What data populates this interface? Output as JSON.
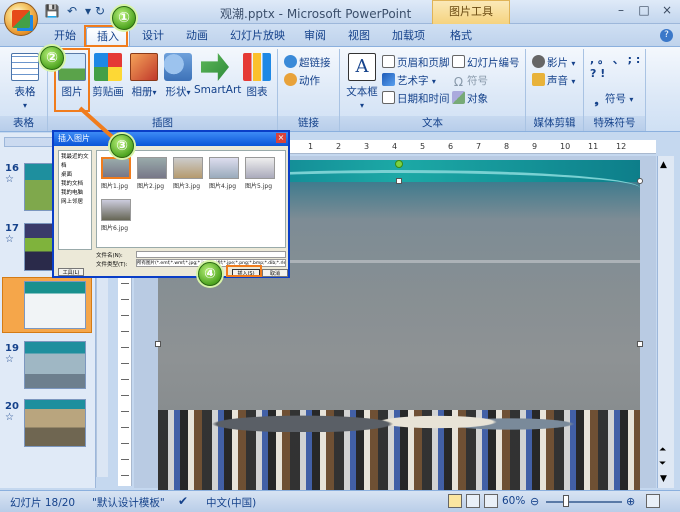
{
  "window": {
    "title": "观潮.pptx - Microsoft PowerPoint",
    "context_tab_title": "图片工具",
    "controls": [
      "–",
      "□",
      "×"
    ]
  },
  "tabs": [
    "开始",
    "插入",
    "设计",
    "动画",
    "幻灯片放映",
    "审阅",
    "视图",
    "加载项",
    "格式"
  ],
  "active_tab": "插入",
  "ribbon": {
    "groups": {
      "table": {
        "label": "表格",
        "button": "表格"
      },
      "illustrations": {
        "label": "插图",
        "buttons": [
          "图片",
          "剪贴画",
          "相册",
          "形状",
          "SmartArt",
          "图表"
        ]
      },
      "links": {
        "label": "链接",
        "buttons": [
          "超链接",
          "动作"
        ]
      },
      "text": {
        "label": "文本",
        "big": "文本框",
        "buttons": [
          "页眉和页脚",
          "幻灯片编号",
          "艺术字",
          "符号",
          "日期和时间",
          "对象"
        ]
      },
      "media": {
        "label": "媒体剪辑",
        "buttons": [
          "影片",
          "声音"
        ]
      },
      "special": {
        "label": "特殊符号",
        "symbols": ", 。 、 ; : ? !",
        "button": "符号"
      }
    }
  },
  "slides": [
    {
      "num": "16",
      "mark": "☆"
    },
    {
      "num": "17",
      "mark": "☆"
    },
    {
      "num": "18",
      "mark": "☆"
    },
    {
      "num": "19",
      "mark": "☆"
    },
    {
      "num": "20",
      "mark": "☆"
    }
  ],
  "ruler_numbers": [
    "4",
    "3",
    "2",
    "1",
    "0",
    "1",
    "2",
    "3",
    "4",
    "5",
    "6",
    "7",
    "8",
    "9",
    "10",
    "11",
    "12"
  ],
  "dialog": {
    "title": "插入图片",
    "places": [
      "我最近的文档",
      "桌面",
      "我的文档",
      "我的电脑",
      "网上邻居"
    ],
    "files": [
      "图片1.jpg",
      "图片2.jpg",
      "图片3.jpg",
      "图片4.jpg",
      "图片5.jpg",
      "图片6.jpg"
    ],
    "filename_label": "文件名(N):",
    "filetype_label": "文件类型(T):",
    "filetype_value": "所有图片(*.emf;*.wmf;*.jpg;*.jpeg;*.jfif;*.jpe;*.png;*.bmp;*.dib;*.rle;*.gif;*.emz;*.wmz)",
    "tools": "工具(L)",
    "insert": "插入(S)",
    "cancel": "取消"
  },
  "callouts": [
    "①",
    "②",
    "③",
    "④"
  ],
  "status": {
    "slide_info": "幻灯片 18/20",
    "theme": "\"默认设计模板\"",
    "language": "中文(中国)",
    "zoom": "60%"
  }
}
